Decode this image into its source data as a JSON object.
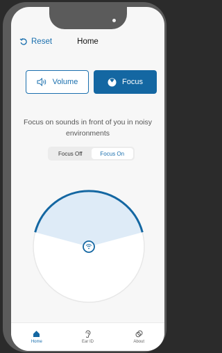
{
  "header": {
    "reset_label": "Reset",
    "title": "Home"
  },
  "modes": {
    "volume_label": "Volume",
    "focus_label": "Focus",
    "selected": "Focus"
  },
  "description": "Focus on sounds in front of you in noisy environments",
  "focus_toggle": {
    "off_label": "Focus Off",
    "on_label": "Focus On",
    "selected": "Focus On"
  },
  "tabbar": {
    "items": [
      {
        "label": "Home",
        "icon": "home-icon"
      },
      {
        "label": "Ear ID",
        "icon": "ear-icon"
      },
      {
        "label": "About",
        "icon": "about-icon"
      }
    ],
    "active": "Home"
  },
  "colors": {
    "accent": "#1467a2",
    "beam_fill": "#deebf7",
    "screen_bg": "#f7f7f7"
  }
}
